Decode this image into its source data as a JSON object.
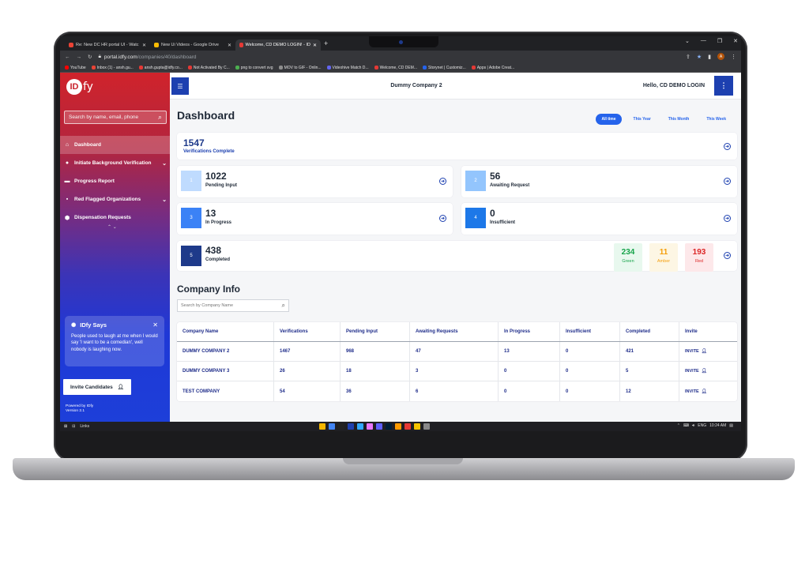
{
  "browser": {
    "tabs": [
      {
        "label": "Re: New DC HR portal UI - Watc",
        "color": "#ea4335"
      },
      {
        "label": "New Ui Videos - Google Drive",
        "color": "#fbbc04"
      },
      {
        "label": "Welcome, CD DEMO LOGIN! - ID",
        "color": "#e53935"
      }
    ],
    "url_host": "portal.idfy.com",
    "url_path": "/companies/40/dashboard",
    "bookmarks": [
      {
        "label": "YouTube",
        "color": "#ff0000"
      },
      {
        "label": "Inbox (1) - ansh.gu...",
        "color": "#ea4335"
      },
      {
        "label": "ansh.gupta@idfy.co...",
        "color": "#e53935"
      },
      {
        "label": "Not Activated By C...",
        "color": "#e53935"
      },
      {
        "label": "png to convert svg",
        "color": "#4caf50"
      },
      {
        "label": "MOV to GIF - Onlin...",
        "color": "#8e8e8e"
      },
      {
        "label": "Videohive Match D...",
        "color": "#6366f1"
      },
      {
        "label": "Welcome, CD DEM...",
        "color": "#e53935"
      },
      {
        "label": "Storynet | Customiz...",
        "color": "#2563eb"
      },
      {
        "label": "Apps | Adobe Creat...",
        "color": "#e53935"
      }
    ]
  },
  "sidebar": {
    "logo": "IDfy",
    "search_placeholder": "Search by name, email, phone",
    "items": [
      {
        "label": "Dashboard",
        "icon": "home-icon"
      },
      {
        "label": "Initiate Background Verification",
        "icon": "person-icon"
      },
      {
        "label": "Progress Report",
        "icon": "report-icon"
      },
      {
        "label": "Red Flagged Organizations",
        "icon": "flag-icon"
      },
      {
        "label": "Dispensation Requests",
        "icon": "shield-icon"
      }
    ],
    "says_title": "IDfy Says",
    "says_text": "People used to laugh at me when I would say 'I want to be a comedian', well nobody is laughing now.",
    "invite_label": "Invite Candidates",
    "powered_by": "Powered by IDfy",
    "version": "Version 2.1"
  },
  "topbar": {
    "company": "Dummy Company 2",
    "greeting": "Hello, CD DEMO LOGIN"
  },
  "dashboard": {
    "title": "Dashboard",
    "filters": [
      "All time",
      "This Year",
      "This Month",
      "This Week"
    ],
    "active_filter": "All time",
    "total": {
      "value": "1547",
      "label": "Verifications Complete"
    },
    "stats": [
      {
        "num": "1",
        "value": "1022",
        "label": "Pending Input",
        "color": "#bfdbfe"
      },
      {
        "num": "2",
        "value": "56",
        "label": "Awaiting Request",
        "color": "#93c5fd"
      },
      {
        "num": "3",
        "value": "13",
        "label": "In Progress",
        "color": "#3b82f6"
      },
      {
        "num": "4",
        "value": "0",
        "label": "Insufficient",
        "color": "#1d78e8"
      },
      {
        "num": "5",
        "value": "438",
        "label": "Completed",
        "color": "#1e3a8a"
      }
    ],
    "breakdown": [
      {
        "value": "234",
        "label": "Green",
        "color": "#16a34a",
        "bg": "#e8f8ee"
      },
      {
        "value": "11",
        "label": "Amber",
        "color": "#f59e0b",
        "bg": "#fdf6e4"
      },
      {
        "value": "193",
        "label": "Red",
        "color": "#dc2626",
        "bg": "#fde8ea"
      }
    ]
  },
  "company_info": {
    "title": "Company Info",
    "search_placeholder": "Search by Company Name",
    "columns": [
      "Company Name",
      "Verifications",
      "Pending Input",
      "Awaiting Requests",
      "In Progress",
      "Insufficient",
      "Completed",
      "Invite"
    ],
    "rows": [
      {
        "name": "DUMMY COMPANY 2",
        "verifications": "1467",
        "pending": "968",
        "awaiting": "47",
        "progress": "13",
        "insufficient": "0",
        "completed": "421",
        "invite": "INVITE"
      },
      {
        "name": "DUMMY COMPANY 3",
        "verifications": "26",
        "pending": "18",
        "awaiting": "3",
        "progress": "0",
        "insufficient": "0",
        "completed": "5",
        "invite": "INVITE"
      },
      {
        "name": "TEST COMPANY",
        "verifications": "54",
        "pending": "36",
        "awaiting": "6",
        "progress": "0",
        "insufficient": "0",
        "completed": "12",
        "invite": "INVITE"
      }
    ]
  },
  "taskbar": {
    "links_label": "Links",
    "lang": "ENG",
    "time": "10:24 AM",
    "app_colors": [
      "#f5b700",
      "#4285f4",
      "#222",
      "#1e40af",
      "#31a8ff",
      "#ea77ff",
      "#5f5fff",
      "#001e36",
      "#ff9a00",
      "#e53935",
      "#f5c400",
      "#888"
    ]
  }
}
